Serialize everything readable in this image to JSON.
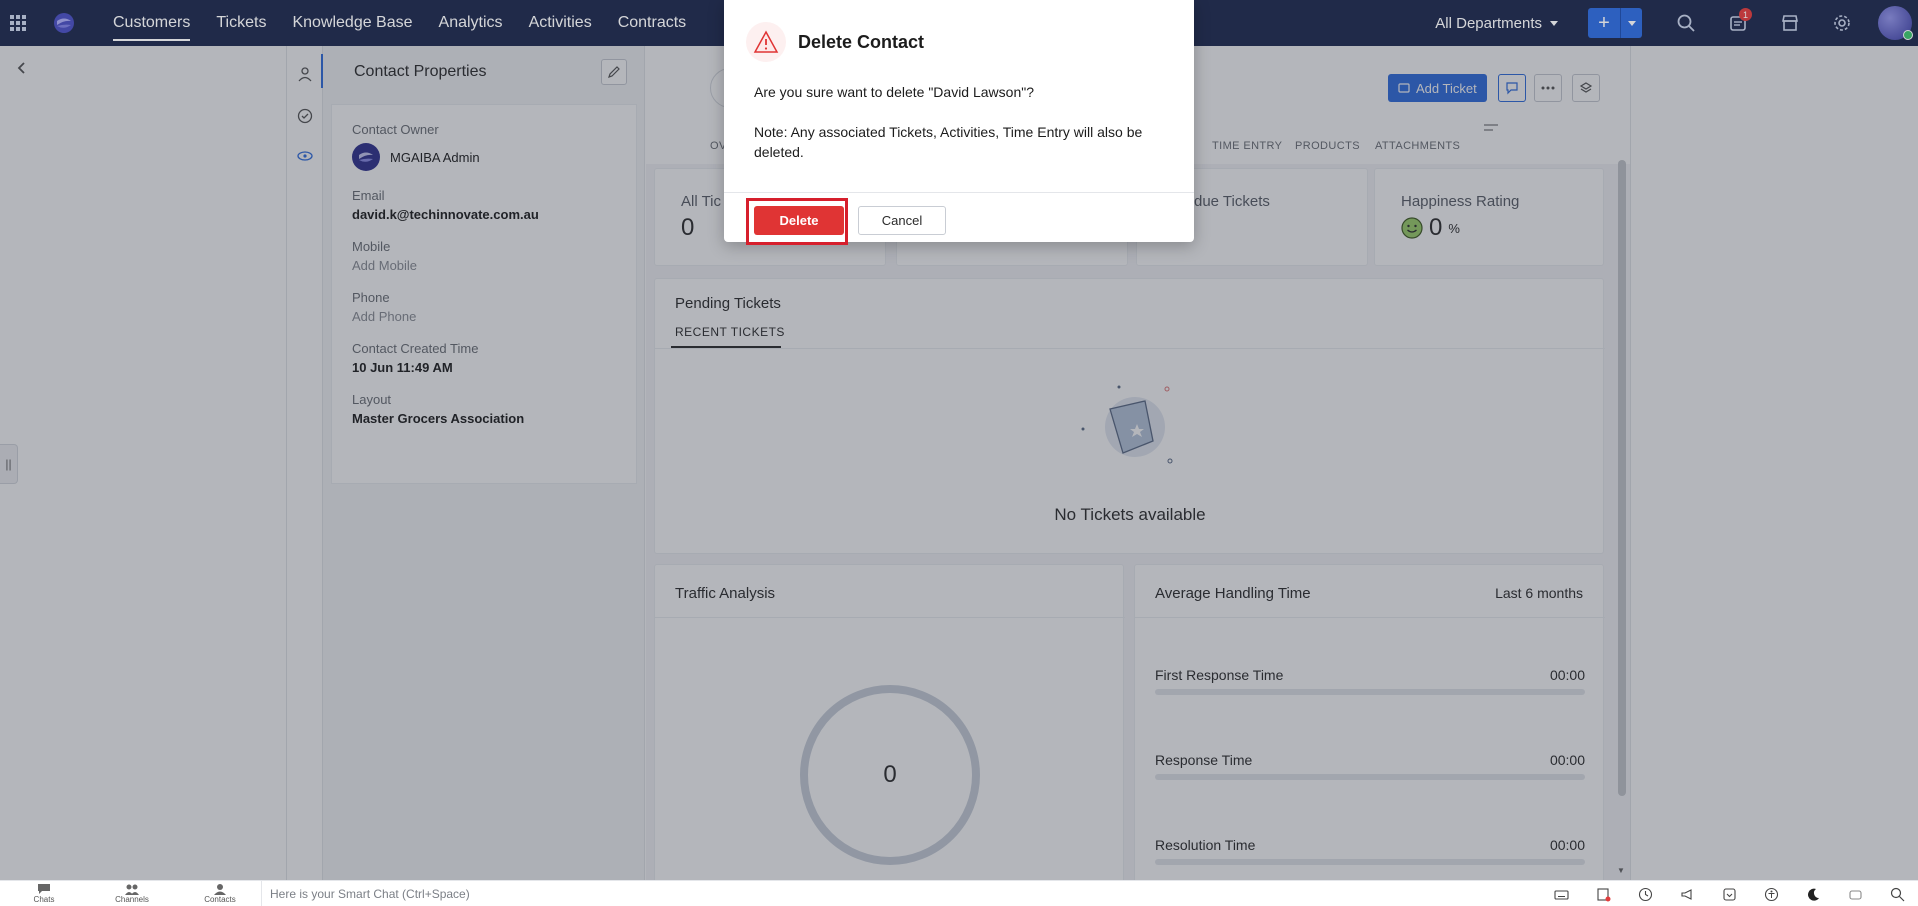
{
  "topbar": {
    "nav": [
      "Customers",
      "Tickets",
      "Knowledge Base",
      "Analytics",
      "Activities",
      "Contracts"
    ],
    "active_nav": "Customers",
    "department": "All Departments",
    "notification_count": "1"
  },
  "properties": {
    "title": "Contact Properties",
    "owner_label": "Contact Owner",
    "owner_name": "MGAIBA Admin",
    "email_label": "Email",
    "email_value": "david.k@techinnovate.com.au",
    "mobile_label": "Mobile",
    "mobile_value": "Add Mobile",
    "phone_label": "Phone",
    "phone_value": "Add Phone",
    "created_label": "Contact Created Time",
    "created_value": "10 Jun 11:49 AM",
    "layout_label": "Layout",
    "layout_value": "Master Grocers Association"
  },
  "header": {
    "add_ticket": "Add Ticket",
    "tabs": [
      "OV",
      "TIME ENTRY",
      "PRODUCTS",
      "ATTACHMENTS"
    ]
  },
  "stats": {
    "all_tickets_label": "All Tic",
    "all_tickets_value": "0",
    "overdue_label": "rdue Tickets",
    "happiness_label": "Happiness Rating",
    "happiness_value": "0",
    "happiness_unit": "%"
  },
  "pending": {
    "title": "Pending Tickets",
    "subtab": "RECENT TICKETS",
    "empty_text": "No Tickets available"
  },
  "traffic": {
    "title": "Traffic Analysis",
    "center_value": "0"
  },
  "aht": {
    "title": "Average Handling Time",
    "range": "Last 6 months",
    "rows": [
      {
        "label": "First Response Time",
        "value": "00:00"
      },
      {
        "label": "Response Time",
        "value": "00:00"
      },
      {
        "label": "Resolution Time",
        "value": "00:00"
      }
    ]
  },
  "modal": {
    "title": "Delete Contact",
    "question": "Are you sure want to delete \"David Lawson\"?",
    "note": "Note: Any associated Tickets, Activities, Time Entry will also be deleted.",
    "delete_label": "Delete",
    "cancel_label": "Cancel"
  },
  "bottombar": {
    "items": [
      "Chats",
      "Channels",
      "Contacts"
    ],
    "smart_chat_placeholder": "Here is your Smart Chat (Ctrl+Space)"
  },
  "colors": {
    "topbar": "#1e2a4d",
    "accent": "#2f6de0",
    "danger": "#e03434",
    "highlight": "#d61f2c"
  }
}
